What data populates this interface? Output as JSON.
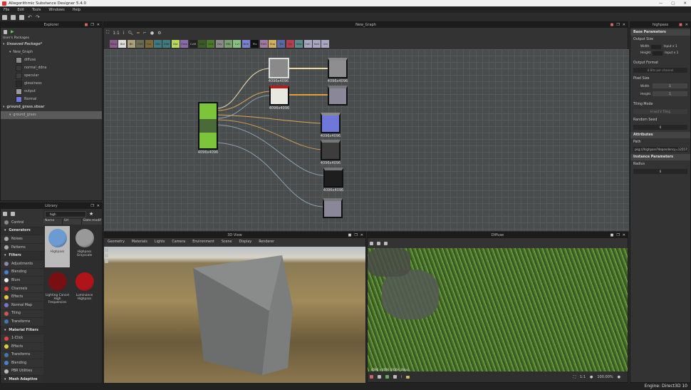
{
  "app": {
    "title": "Allegorithmic Substance Designer 5.4.0",
    "menu": [
      "File",
      "Edit",
      "Tools",
      "Windows",
      "Help"
    ]
  },
  "explorer": {
    "title": "Explorer",
    "section": "User's Packages",
    "items": [
      {
        "label": "Unsaved Package*",
        "level": 0,
        "color": null
      },
      {
        "label": "New_Graph",
        "level": 1,
        "color": null
      },
      {
        "label": "diffuse",
        "level": 2,
        "color": "#8a8a8a"
      },
      {
        "label": "normal_ddna",
        "level": 2,
        "color": "#3a3a3a"
      },
      {
        "label": "specular",
        "level": 2,
        "color": "#3e3e3e"
      },
      {
        "label": "glossiness",
        "level": 2,
        "color": "#2a2a2a"
      },
      {
        "label": "output",
        "level": 2,
        "color": "#9a9a9a"
      },
      {
        "label": "Normal",
        "level": 2,
        "color": "#6f78d8"
      },
      {
        "label": "ground_grass.sbsar",
        "level": 0,
        "color": null
      },
      {
        "label": "ground_grass",
        "level": 1,
        "color": null
      }
    ]
  },
  "library": {
    "title": "Library",
    "search": "high",
    "columns": [
      "Name",
      "Url",
      "Date modif"
    ],
    "categories": [
      {
        "label": "Control",
        "header": false,
        "color": "#888"
      },
      {
        "label": "Generators",
        "header": true,
        "color": null
      },
      {
        "label": "Noises",
        "header": false,
        "color": "#aaa"
      },
      {
        "label": "Patterns",
        "header": false,
        "color": "#aaa"
      },
      {
        "label": "Filters",
        "header": true,
        "color": null
      },
      {
        "label": "Adjustments",
        "header": false,
        "color": "#88a"
      },
      {
        "label": "Blending",
        "header": false,
        "color": "#4a7fd0"
      },
      {
        "label": "Blurs",
        "header": false,
        "color": "#eee"
      },
      {
        "label": "Channels",
        "header": false,
        "color": "#d44"
      },
      {
        "label": "Effects",
        "header": false,
        "color": "#dc4"
      },
      {
        "label": "Normal Map",
        "header": false,
        "color": "#77c"
      },
      {
        "label": "Tiling",
        "header": false,
        "color": "#c55"
      },
      {
        "label": "Transforms",
        "header": false,
        "color": "#47a"
      },
      {
        "label": "Material Filters",
        "header": true,
        "color": null
      },
      {
        "label": "1-Click",
        "header": false,
        "color": "#d44"
      },
      {
        "label": "Effects",
        "header": false,
        "color": "#dc4"
      },
      {
        "label": "Transforms",
        "header": false,
        "color": "#47a"
      },
      {
        "label": "Blending",
        "header": false,
        "color": "#4a7fd0"
      },
      {
        "label": "PBR Utilities",
        "header": false,
        "color": "#bbb"
      },
      {
        "label": "Mesh Adaptive",
        "header": true,
        "color": null
      }
    ],
    "results": [
      {
        "label": "Highpass",
        "color": "#6b9bd0",
        "selected": true
      },
      {
        "label": "Highpass Grayscale",
        "color": "#999",
        "selected": false
      },
      {
        "label": "Lighting Cancel High Frequencies",
        "color": "#7a0f12",
        "selected": false
      },
      {
        "label": "Luminance Highpass",
        "color": "#b0141a",
        "selected": false
      }
    ]
  },
  "graph": {
    "title": "New_Graph",
    "atomic_nodes": [
      {
        "label": "Bmp",
        "color": "#8a5a8a"
      },
      {
        "label": "Bld",
        "color": "#ddd"
      },
      {
        "label": "Blr",
        "color": "#a99f7a"
      },
      {
        "label": "ChS",
        "color": "#6a6a55"
      },
      {
        "label": "Crv",
        "color": "#7a6a3a"
      },
      {
        "label": "DBl",
        "color": "#3f7a80"
      },
      {
        "label": "DWr",
        "color": "#3f7a80"
      },
      {
        "label": "Dst",
        "color": "#b8d860"
      },
      {
        "label": "Emb",
        "color": "#8a6aa8"
      },
      {
        "label": "CvM",
        "color": "#222"
      },
      {
        "label": "GrD",
        "color": "#3a5a2a"
      },
      {
        "label": "Grd",
        "color": "#4a7a2a"
      },
      {
        "label": "Gry",
        "color": "#8a8a8a"
      },
      {
        "label": "HSL",
        "color": "#7aa070"
      },
      {
        "label": "Lvl",
        "color": "#8ac080"
      },
      {
        "label": "Nrm",
        "color": "#7a80d0"
      },
      {
        "label": "Pix",
        "color": "#111"
      },
      {
        "label": "SVG",
        "color": "#a07aa0"
      },
      {
        "label": "Shp",
        "color": "#d0b060"
      },
      {
        "label": "Trs",
        "color": "#5a6aa0"
      },
      {
        "label": "Clr",
        "color": "#b04050"
      },
      {
        "label": "Wrp",
        "color": "#5a8a8a"
      },
      {
        "label": "1nC",
        "color": "#aaa8c0"
      },
      {
        "label": "SnG",
        "color": "#aaa8c0"
      },
      {
        "label": "Uni",
        "color": "#aaa8c0"
      }
    ],
    "node_size_label": "4096x4096"
  },
  "view3d": {
    "title": "3D View",
    "tabs": [
      "Geometry",
      "Materials",
      "Lights",
      "Camera",
      "Environment",
      "Scene",
      "Display",
      "Renderer"
    ]
  },
  "view2d": {
    "title": "Diffuse",
    "size_info": "4096 x 4096 (RGBA, 8bpc)",
    "zoom": "100.00%",
    "zoom_label": "1:1"
  },
  "properties": {
    "title": "highpass",
    "base_parameters": "Base Parameters",
    "output_size": "Output Size",
    "width": "Width",
    "height": "Height",
    "input_x1": "Input x 1",
    "output_format": "Output Format",
    "output_format_value": "8 Bits per channel",
    "pixel_size": "Pixel Size",
    "pixel_width": "1",
    "pixel_height": "1",
    "tiling_mode": "Tiling Mode",
    "tiling_value": "H and V Tiling",
    "random_seed": "Random Seed",
    "random_seed_value": "0",
    "attributes": "Attributes",
    "path_label": "Path",
    "path_value": "pkg:///highpass?dependency=1255798919",
    "instance_parameters": "Instance Parameters",
    "radius_label": "Radius",
    "radius_value": "6"
  },
  "status": {
    "engine": "Engine: Direct3D 10"
  }
}
